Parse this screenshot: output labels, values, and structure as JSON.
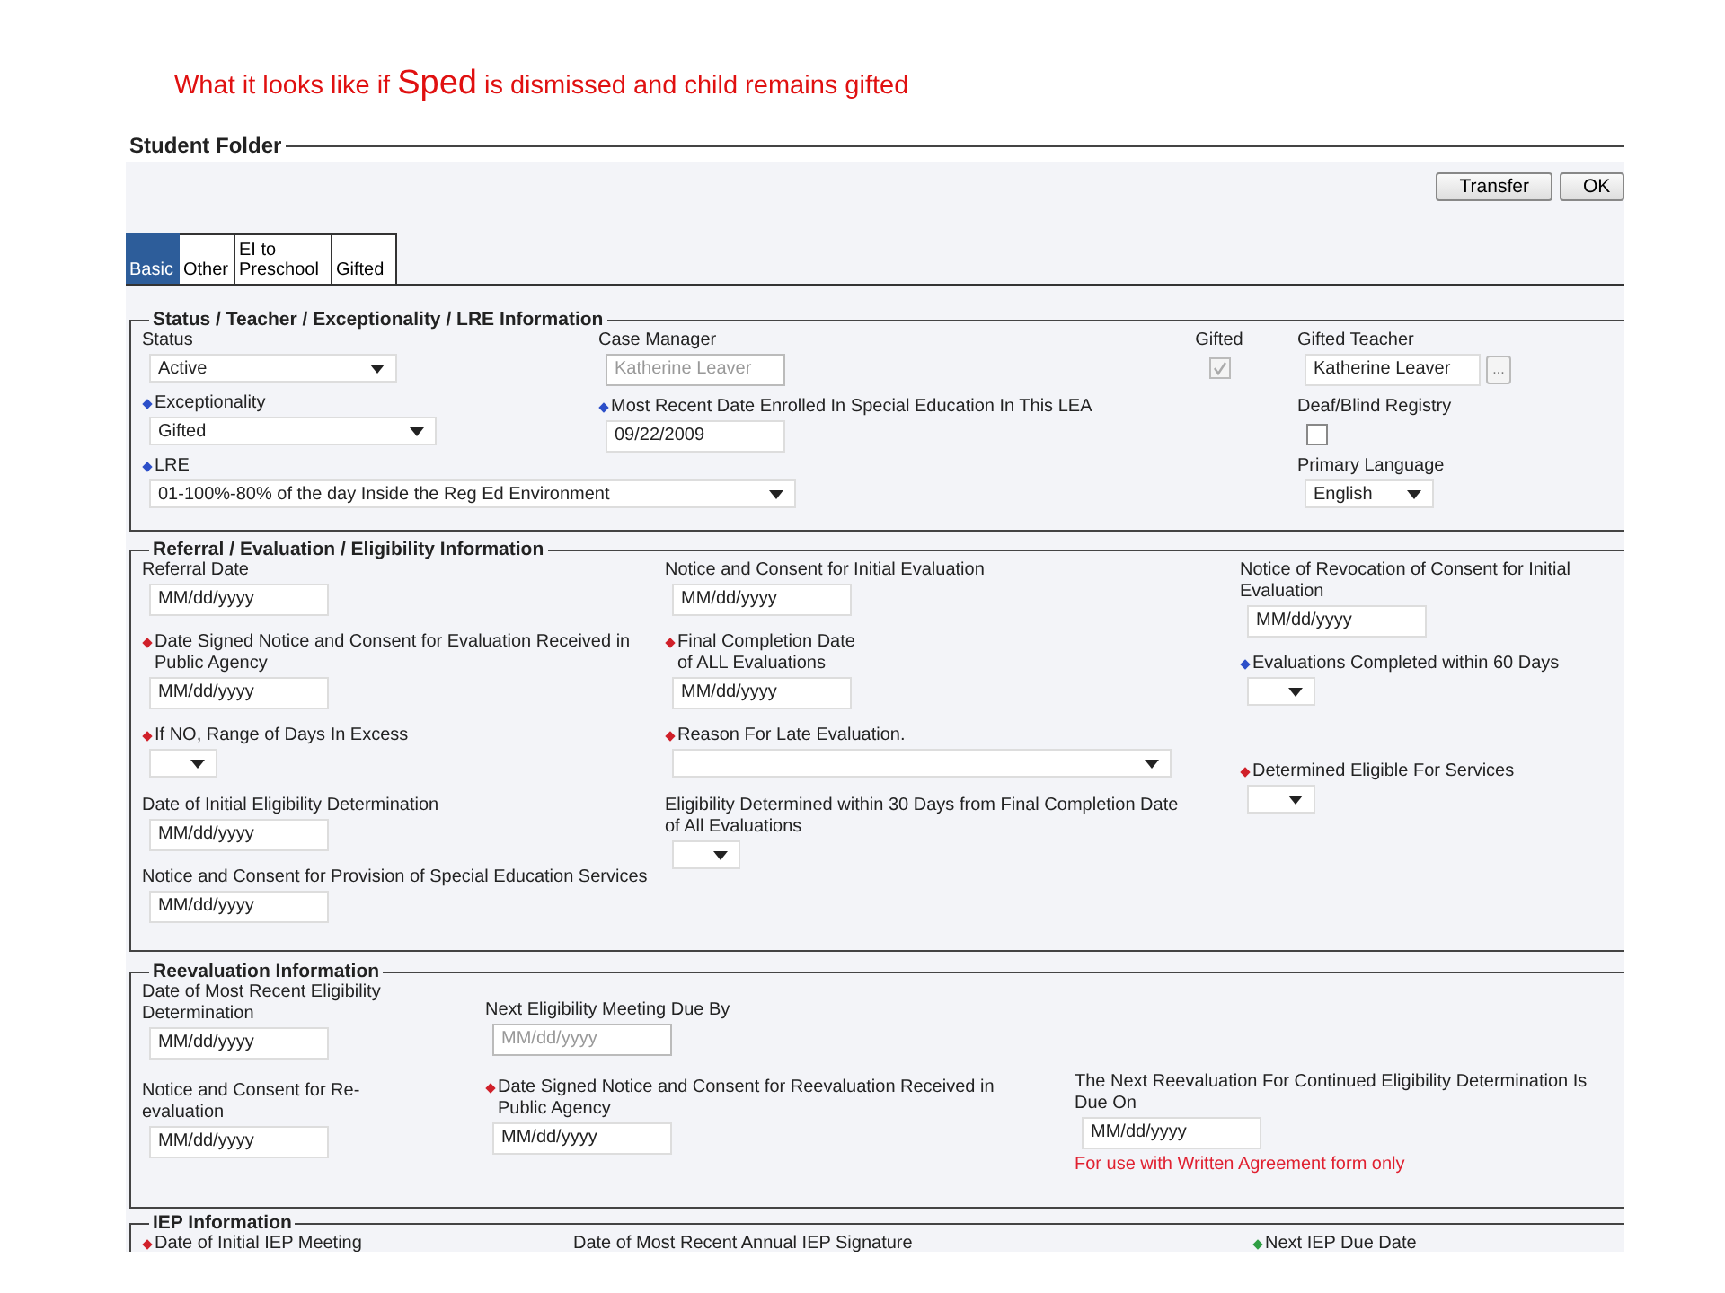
{
  "caption": [
    {
      "kind": "normal",
      "text": "What it looks like if "
    },
    {
      "kind": "large",
      "text": "Sped"
    },
    {
      "kind": "normal",
      "text": " is dismissed and child remains gifted"
    }
  ],
  "window": {
    "title": "Student Folder"
  },
  "buttons": [
    "Transfer",
    "OK"
  ],
  "tabs": [
    {
      "label": "Basic",
      "selected": true
    },
    {
      "label": "Other",
      "selected": false
    },
    {
      "label": "EI to Preschool",
      "selected": false
    },
    {
      "label": "Gifted",
      "selected": false
    }
  ],
  "sections": [
    {
      "title": "Status / Teacher / Exceptionality / LRE Information",
      "columns": [
        [
          {
            "label": "Status",
            "kind": "select",
            "value": "Active"
          },
          {
            "label": "Exceptionality",
            "color": "#2c4fc9",
            "kind": "select",
            "value": "Gifted"
          },
          {
            "label": "LRE",
            "color": "#2c4fc9",
            "kind": "select",
            "value": "01-100%-80% of the day Inside the Reg Ed Environment"
          }
        ],
        [
          {
            "label": "Case Manager",
            "kind": "text",
            "value": "Katherine Leaver",
            "disabled": true
          },
          {
            "label": "Most Recent Date Enrolled In Special Education In This LEA",
            "color": "#2c4fc9",
            "kind": "text",
            "value": "09/22/2009",
            "disabled": false
          }
        ],
        [
          {
            "label": "Gifted",
            "kind": "checkbox",
            "checked": true,
            "disabled": true
          }
        ],
        [
          {
            "label": "Gifted Teacher",
            "kind": "lookup",
            "value": "Katherine Leaver",
            "button": "..."
          },
          {
            "label": "Deaf/Blind Registry",
            "kind": "checkbox",
            "checked": false,
            "disabled": false
          },
          {
            "label": "Primary Language",
            "kind": "select",
            "value": "English"
          }
        ]
      ]
    },
    {
      "title": "Referral / Evaluation / Eligibility Information",
      "columns": [
        [
          {
            "label": "Referral Date",
            "kind": "date",
            "placeholder": "MM/dd/yyyy"
          },
          {
            "label": "Date Signed Notice and Consent for Evaluation Received in Public Agency",
            "color": "#d0202a",
            "kind": "date",
            "placeholder": "MM/dd/yyyy"
          },
          {
            "label": "If NO, Range of Days In Excess",
            "color": "#d0202a",
            "kind": "select"
          },
          {
            "label": "Date of Initial Eligibility Determination",
            "kind": "date",
            "placeholder": "MM/dd/yyyy"
          },
          {
            "label": "Notice and Consent for Provision of Special Education Services",
            "kind": "date",
            "placeholder": "MM/dd/yyyy"
          }
        ],
        [
          {
            "label": "Notice and Consent for Initial Evaluation",
            "kind": "date",
            "placeholder": "MM/dd/yyyy"
          },
          {
            "label": "Final Completion Date of ALL Evaluations",
            "color": "#d0202a",
            "kind": "date",
            "placeholder": "MM/dd/yyyy"
          },
          {
            "label": "Reason For Late Evaluation.",
            "color": "#d0202a",
            "kind": "select"
          },
          {
            "label": "Eligibility Determined within 30 Days from Final Completion Date of All Evaluations",
            "kind": "select"
          }
        ],
        [
          {
            "label": "Notice of Revocation of Consent for Initial Evaluation",
            "kind": "date",
            "placeholder": "MM/dd/yyyy"
          },
          {
            "label": "Evaluations Completed within 60 Days",
            "color": "#2c4fc9",
            "kind": "select"
          },
          {
            "label": "Determined Eligible For Services",
            "color": "#d0202a",
            "kind": "select"
          }
        ]
      ]
    },
    {
      "title": "Reevaluation Information",
      "columns": [
        [
          {
            "label": "Date of Most Recent Eligibility Determination",
            "kind": "date",
            "placeholder": "MM/dd/yyyy"
          },
          {
            "label": "Notice and Consent for Re-evaluation",
            "kind": "date",
            "placeholder": "MM/dd/yyyy"
          }
        ],
        [
          {
            "label": "Next Eligibility Meeting Due By",
            "kind": "date",
            "placeholder": "MM/dd/yyyy",
            "disabled": true
          },
          {
            "label": "Date Signed Notice and Consent for Reevaluation Received in Public Agency",
            "color": "#d0202a",
            "kind": "date",
            "placeholder": "MM/dd/yyyy"
          }
        ],
        [
          {
            "label": "The Next Reevaluation For Continued Eligibility Determination Is Due On",
            "kind": "date",
            "placeholder": "MM/dd/yyyy",
            "note": "For use with Written Agreement form only"
          }
        ]
      ]
    },
    {
      "title": "IEP Information",
      "columns": [
        [
          {
            "label": "Date of Initial IEP Meeting",
            "color": "#d0202a",
            "kind": "label"
          }
        ],
        [
          {
            "label": "Date of Most Recent Annual IEP Signature",
            "kind": "label"
          }
        ],
        [
          {
            "label": "Next IEP Due Date",
            "color": "#2f9e44",
            "kind": "label"
          }
        ]
      ]
    }
  ]
}
